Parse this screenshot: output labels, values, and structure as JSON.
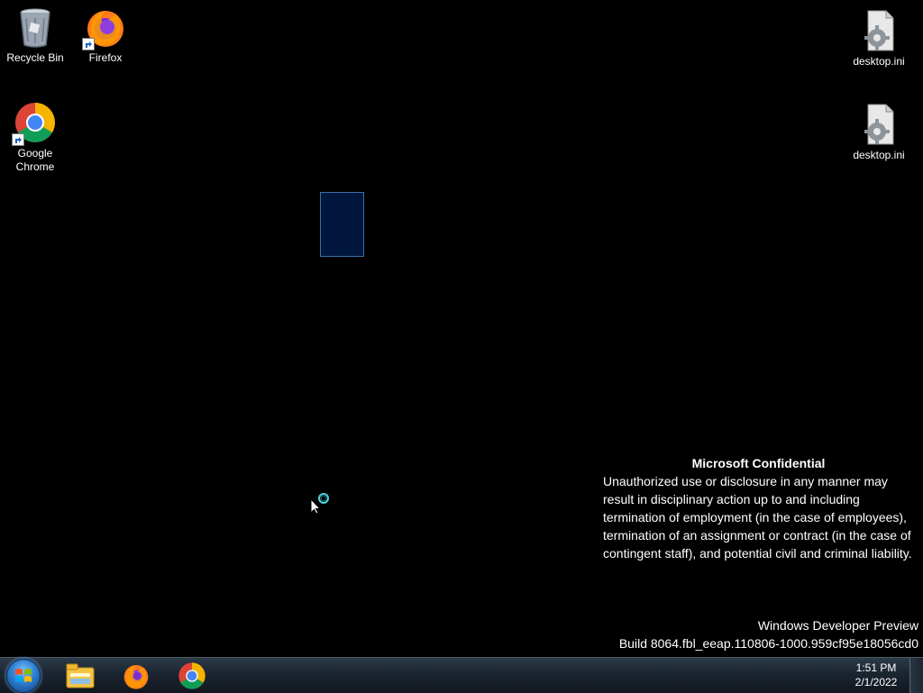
{
  "desktop": {
    "icons_left": [
      {
        "label": "Recycle Bin",
        "icon": "recycle-bin-icon"
      },
      {
        "label": "Firefox",
        "icon": "firefox-icon"
      },
      {
        "label": "Google Chrome",
        "icon": "chrome-icon"
      }
    ],
    "icons_right": [
      {
        "label": "desktop.ini",
        "icon": "settings-file-icon"
      },
      {
        "label": "desktop.ini",
        "icon": "settings-file-icon"
      }
    ]
  },
  "watermark": {
    "heading": "Microsoft Confidential",
    "body": "Unauthorized use or disclosure in any manner may result in disciplinary action up to and including termination of employment (in the case of employees), termination of an assignment or contract (in the case of contingent staff), and potential civil and criminal liability.",
    "edition": "Windows Developer Preview",
    "build": "Build 8064.fbl_eeap.110806-1000.959cf95e18056cd0"
  },
  "taskbar": {
    "start": "start-orb-icon",
    "pinned": [
      {
        "name": "File Explorer",
        "icon": "file-explorer-icon"
      },
      {
        "name": "Firefox",
        "icon": "firefox-icon"
      },
      {
        "name": "Google Chrome",
        "icon": "chrome-icon"
      }
    ],
    "clock": {
      "time": "1:51 PM",
      "date": "2/1/2022"
    }
  },
  "colors": {
    "desktop_bg": "#000000",
    "selection": "#3a6ea5"
  }
}
